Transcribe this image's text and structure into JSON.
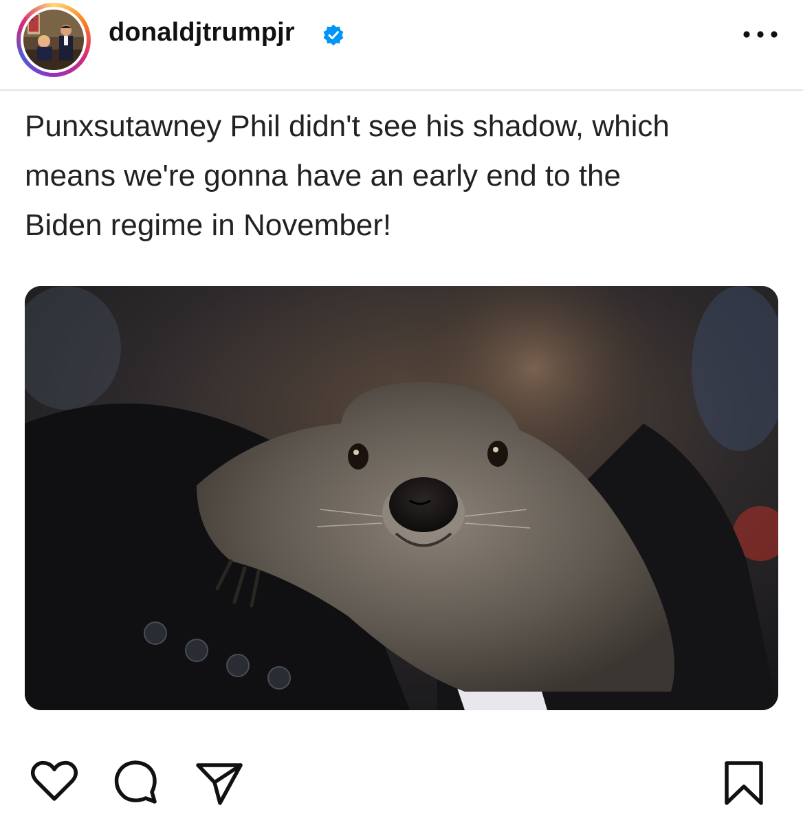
{
  "post": {
    "username": "donaldjtrumpjr",
    "verified": true,
    "caption_lines": [
      "Punxsutawney Phil didn't see his shadow, which",
      "means we're gonna have an early end to the",
      "Biden regime in November!"
    ]
  },
  "icons": {
    "avatar": "profile-avatar",
    "verified": "verified-badge-icon",
    "more": "more-options-icon",
    "like": "heart-icon",
    "comment": "comment-bubble-icon",
    "share": "paper-plane-icon",
    "save": "bookmark-icon"
  },
  "colors": {
    "verified_blue": "#0095f6",
    "text": "#222222",
    "divider": "#e3e3e3"
  }
}
